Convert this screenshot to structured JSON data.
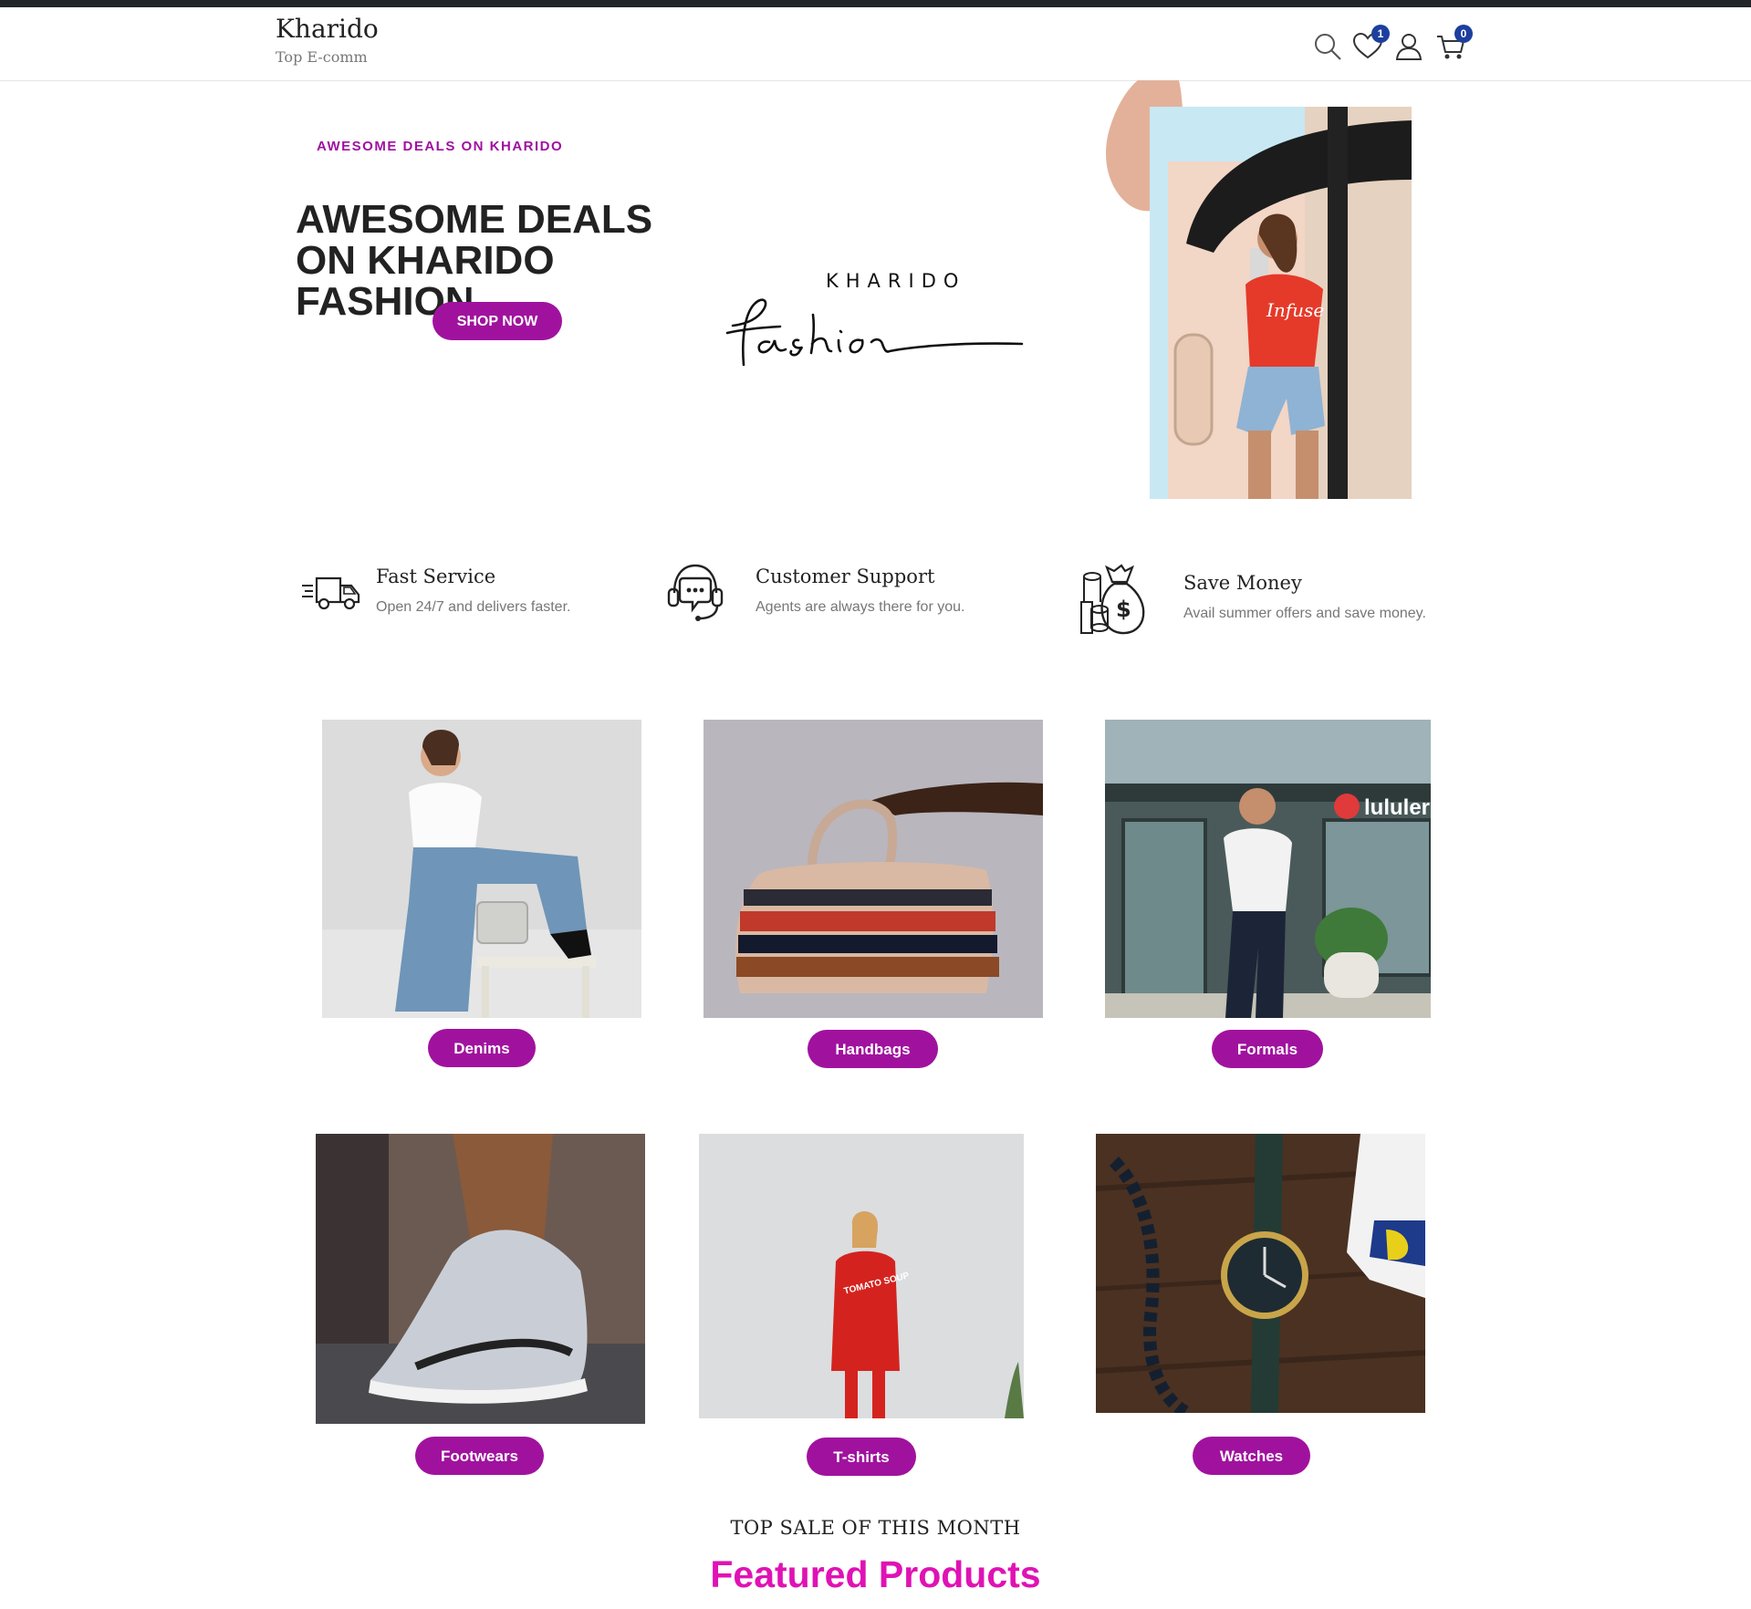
{
  "header": {
    "brand_title": "Kharido",
    "brand_subtitle": "Top E-comm",
    "wishlist_count": "1",
    "cart_count": "0",
    "icons": [
      "search-icon",
      "heart-icon",
      "user-icon",
      "cart-icon"
    ]
  },
  "hero": {
    "kicker": "AWESOME DEALS ON KHARIDO",
    "title": "AWESOME DEALS ON KHARIDO FASHION",
    "button": "SHOP NOW",
    "logo_top": "KHARIDO",
    "logo_script": "fashion",
    "shirt_text": "Infuse"
  },
  "features": [
    {
      "title": "Fast Service",
      "desc": "Open 24/7 and delivers faster.",
      "icon": "delivery-truck-icon"
    },
    {
      "title": "Customer Support",
      "desc": "Agents are always there for you.",
      "icon": "headset-chat-icon"
    },
    {
      "title": "Save Money",
      "desc": "Avail summer offers and save money.",
      "icon": "money-bag-icon"
    }
  ],
  "categories": [
    {
      "label": "Denims"
    },
    {
      "label": "Handbags"
    },
    {
      "label": "Formals",
      "store_sign": "lululer"
    },
    {
      "label": "Footwears"
    },
    {
      "label": "T-shirts",
      "shirt_text": "TOMATO SOUP"
    },
    {
      "label": "Watches"
    }
  ],
  "featured": {
    "subtitle": "TOP SALE OF THIS MONTH",
    "title": "Featured Products"
  },
  "colors": {
    "accent": "#a0129e",
    "featured_title": "#e012b4",
    "badge": "#1d3f9e",
    "topbar": "#212529"
  }
}
